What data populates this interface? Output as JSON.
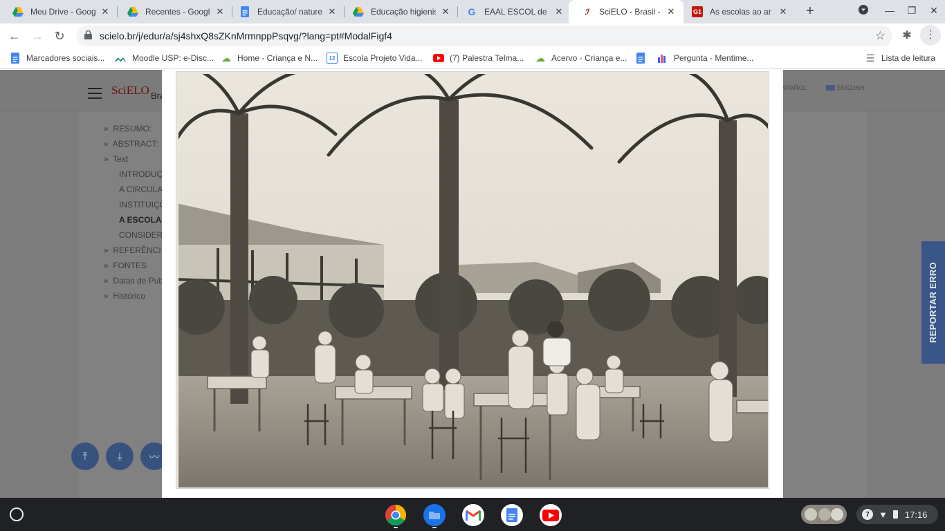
{
  "browser": {
    "tabs": [
      {
        "label": "Meu Drive - Google",
        "icon": "google-drive-icon",
        "active": false
      },
      {
        "label": "Recentes - Google",
        "icon": "google-drive-icon",
        "active": false
      },
      {
        "label": "Educação/ nature",
        "icon": "google-docs-icon",
        "active": false
      },
      {
        "label": "Educação higienis",
        "icon": "google-drive-icon",
        "active": false
      },
      {
        "label": "EAAL ESCOL de ap",
        "icon": "google-icon",
        "active": false
      },
      {
        "label": "SciELO - Brasil - AF",
        "icon": "scielo-icon",
        "active": true
      },
      {
        "label": "As escolas ao ar li",
        "icon": "g1-icon",
        "active": false
      }
    ],
    "url": "scielo.br/j/edur/a/sj4shxQ8sZKnMrmnppPsqvg/?lang=pt#ModalFigf4",
    "bookmarks": [
      {
        "label": "Marcadores sociais...",
        "icon": "google-docs-icon"
      },
      {
        "label": "Moodle USP: e-Disc...",
        "icon": "moodle-icon"
      },
      {
        "label": "Home - Criança e N...",
        "icon": "cloud-icon"
      },
      {
        "label": "Escola Projeto Vida...",
        "icon": "calendar-icon"
      },
      {
        "label": "(7) Palestra Telma...",
        "icon": "youtube-icon"
      },
      {
        "label": "Acervo - Criança e...",
        "icon": "cloud-icon"
      },
      {
        "label": "",
        "icon": "google-docs-icon"
      },
      {
        "label": "Pergunta - Mentime...",
        "icon": "mentimeter-icon"
      }
    ],
    "reading_list": "Lista de leitura"
  },
  "page": {
    "logo": "SciELO",
    "logo_suffix": "Bra",
    "languages": [
      "ESPAÑOL",
      "ENGLISH"
    ],
    "toc": [
      {
        "label": "RESUMO:",
        "level": 0,
        "bold": false
      },
      {
        "label": "ABSTRACT:",
        "level": 0,
        "bold": false
      },
      {
        "label": "Text",
        "level": 0,
        "bold": false
      },
      {
        "label": "INTRODUÇ",
        "level": 1,
        "bold": false
      },
      {
        "label": "A CIRCULA",
        "level": 1,
        "bold": false
      },
      {
        "label": "INSTITUIÇÕ",
        "level": 1,
        "bold": false
      },
      {
        "label": "A ESCOLA",
        "level": 1,
        "bold": true
      },
      {
        "label": "CONSIDER",
        "level": 1,
        "bold": false
      },
      {
        "label": "REFERÊNCI",
        "level": 0,
        "bold": false
      },
      {
        "label": "FONTES",
        "level": 0,
        "bold": false
      },
      {
        "label": "Datas de Pub",
        "level": 0,
        "bold": false
      },
      {
        "label": "Histórico",
        "level": 0,
        "bold": false
      }
    ],
    "report_error": "REPORTAR ERRO"
  },
  "shelf": {
    "apps": [
      "chrome-icon",
      "files-icon",
      "gmail-icon",
      "docs-icon",
      "youtube-icon"
    ],
    "notification_count": "7",
    "time": "17:16"
  },
  "colors": {
    "tabstrip": "#dee1e6",
    "scielo_red": "#6a1010",
    "report_blue": "#3a5688",
    "shelf": "#202124"
  }
}
